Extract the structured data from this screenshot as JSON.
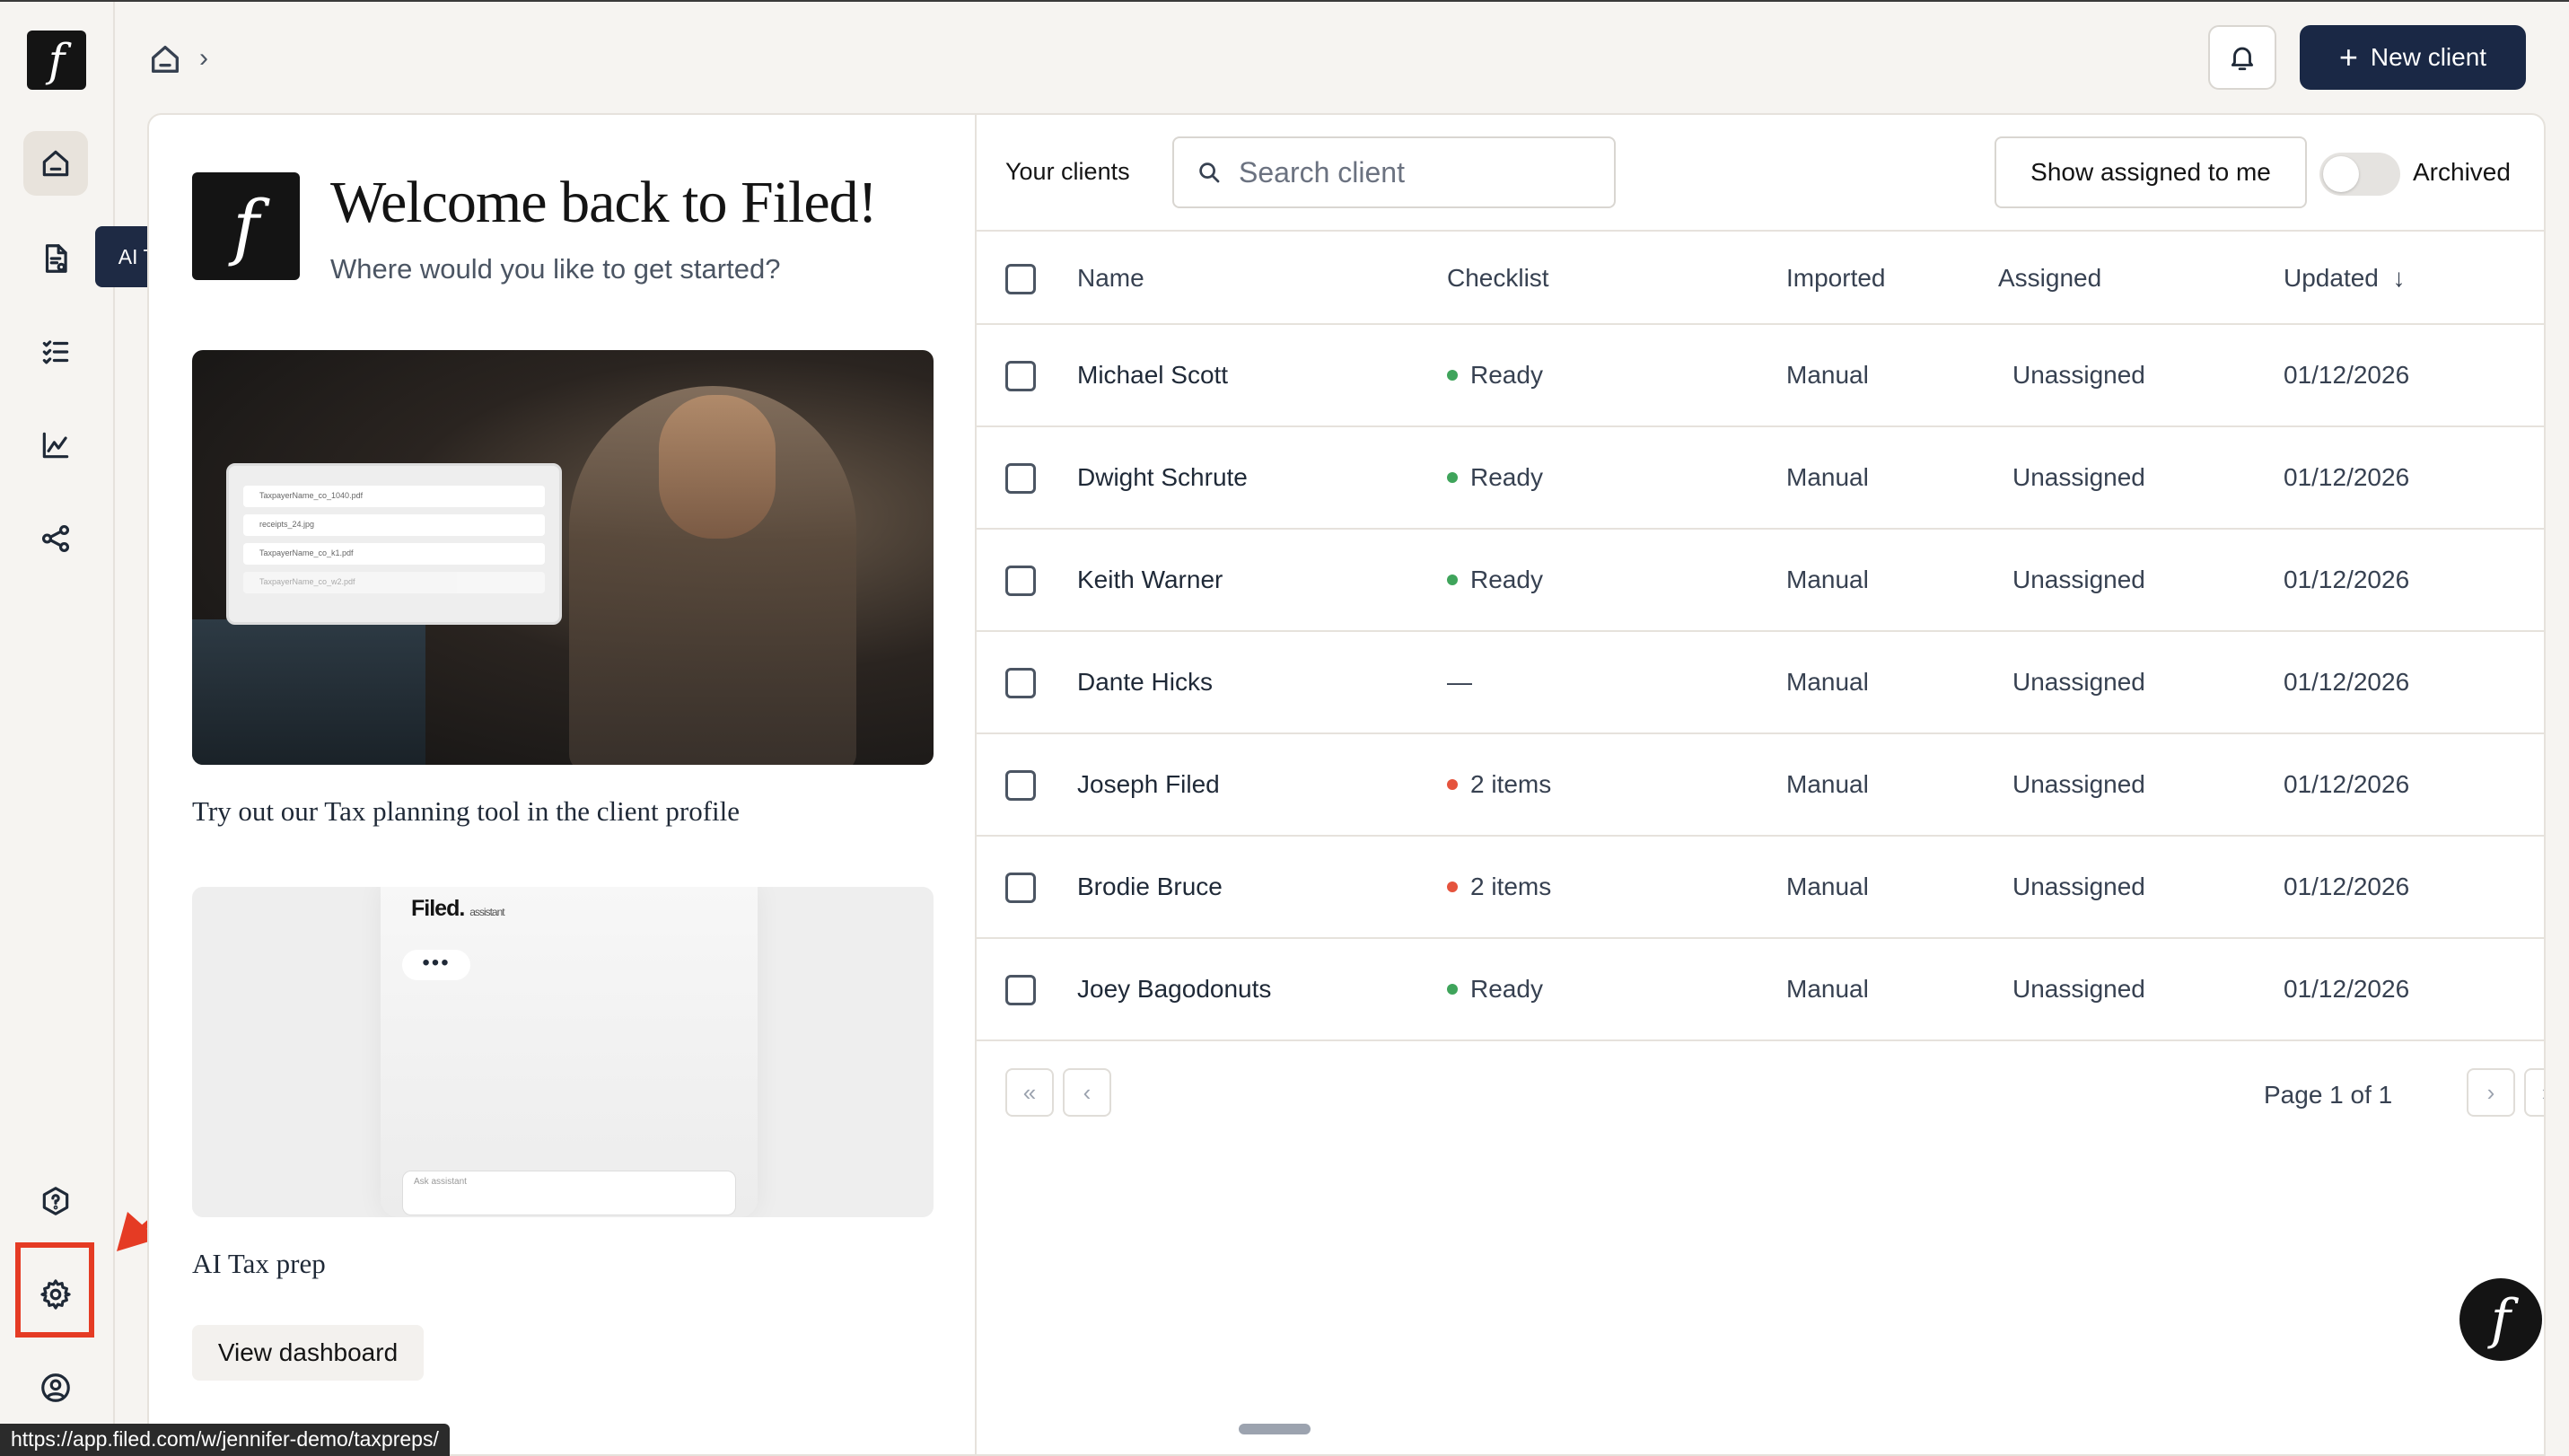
{
  "sidebar": {
    "logo_glyph": "f",
    "tooltip": "AI Tax Prep",
    "items": [
      {
        "name": "home-icon",
        "active": true
      },
      {
        "name": "tax-prep-icon",
        "active": false
      },
      {
        "name": "checklist-icon",
        "active": false
      },
      {
        "name": "analytics-icon",
        "active": false
      },
      {
        "name": "share-icon",
        "active": false
      },
      {
        "name": "help-icon",
        "active": false
      },
      {
        "name": "settings-icon",
        "active": false
      },
      {
        "name": "profile-icon",
        "active": false
      }
    ]
  },
  "topbar": {
    "breadcrumb_sep": "›",
    "new_client_plus": "+",
    "new_client_label": "New client"
  },
  "welcome": {
    "logo_glyph": "f",
    "title": "Welcome back to Filed!",
    "subtitle": "Where would you like to get started?"
  },
  "promo1": {
    "caption": "Try out our Tax planning tool in the client profile",
    "files": [
      "TaxpayerName_co_1040.pdf",
      "receipts_24.jpg",
      "TaxpayerName_co_k1.pdf",
      "TaxpayerName_co_w2.pdf"
    ]
  },
  "promo2": {
    "brand": "Filed.",
    "brand_small": "assistant",
    "dots": "•••",
    "input_placeholder": "Ask assistant",
    "caption": "AI Tax prep",
    "button": "View dashboard"
  },
  "clients": {
    "heading": "Your clients",
    "search_placeholder": "Search client",
    "show_assigned": "Show assigned to me",
    "archived_label": "Archived",
    "archived_on": false,
    "columns": {
      "name": "Name",
      "checklist": "Checklist",
      "imported": "Imported",
      "assigned": "Assigned",
      "updated": "Updated"
    },
    "sort_indicator": "↓",
    "rows": [
      {
        "name": "Michael Scott",
        "checklist": "Ready",
        "status": "ready",
        "imported": "Manual",
        "assigned": "Unassigned",
        "updated": "01/12/2026"
      },
      {
        "name": "Dwight Schrute",
        "checklist": "Ready",
        "status": "ready",
        "imported": "Manual",
        "assigned": "Unassigned",
        "updated": "01/12/2026"
      },
      {
        "name": "Keith Warner",
        "checklist": "Ready",
        "status": "ready",
        "imported": "Manual",
        "assigned": "Unassigned",
        "updated": "01/12/2026"
      },
      {
        "name": "Dante Hicks",
        "checklist": "—",
        "status": "none",
        "imported": "Manual",
        "assigned": "Unassigned",
        "updated": "01/12/2026"
      },
      {
        "name": "Joseph Filed",
        "checklist": "2 items",
        "status": "pending",
        "imported": "Manual",
        "assigned": "Unassigned",
        "updated": "01/12/2026"
      },
      {
        "name": "Brodie Bruce",
        "checklist": "2 items",
        "status": "pending",
        "imported": "Manual",
        "assigned": "Unassigned",
        "updated": "01/12/2026"
      },
      {
        "name": "Joey Bagodonuts",
        "checklist": "Ready",
        "status": "ready",
        "imported": "Manual",
        "assigned": "Unassigned",
        "updated": "01/12/2026"
      }
    ],
    "pagination": {
      "first": "«",
      "prev": "‹",
      "text": "Page 1 of 1",
      "next": "›",
      "last": "»"
    }
  },
  "colors": {
    "ready": "#3fa45b",
    "pending": "#e5533d",
    "accent": "#1a2845",
    "annotation": "#e53b24"
  },
  "fab_glyph": "f",
  "status_url": "https://app.filed.com/w/jennifer-demo/taxpreps/"
}
